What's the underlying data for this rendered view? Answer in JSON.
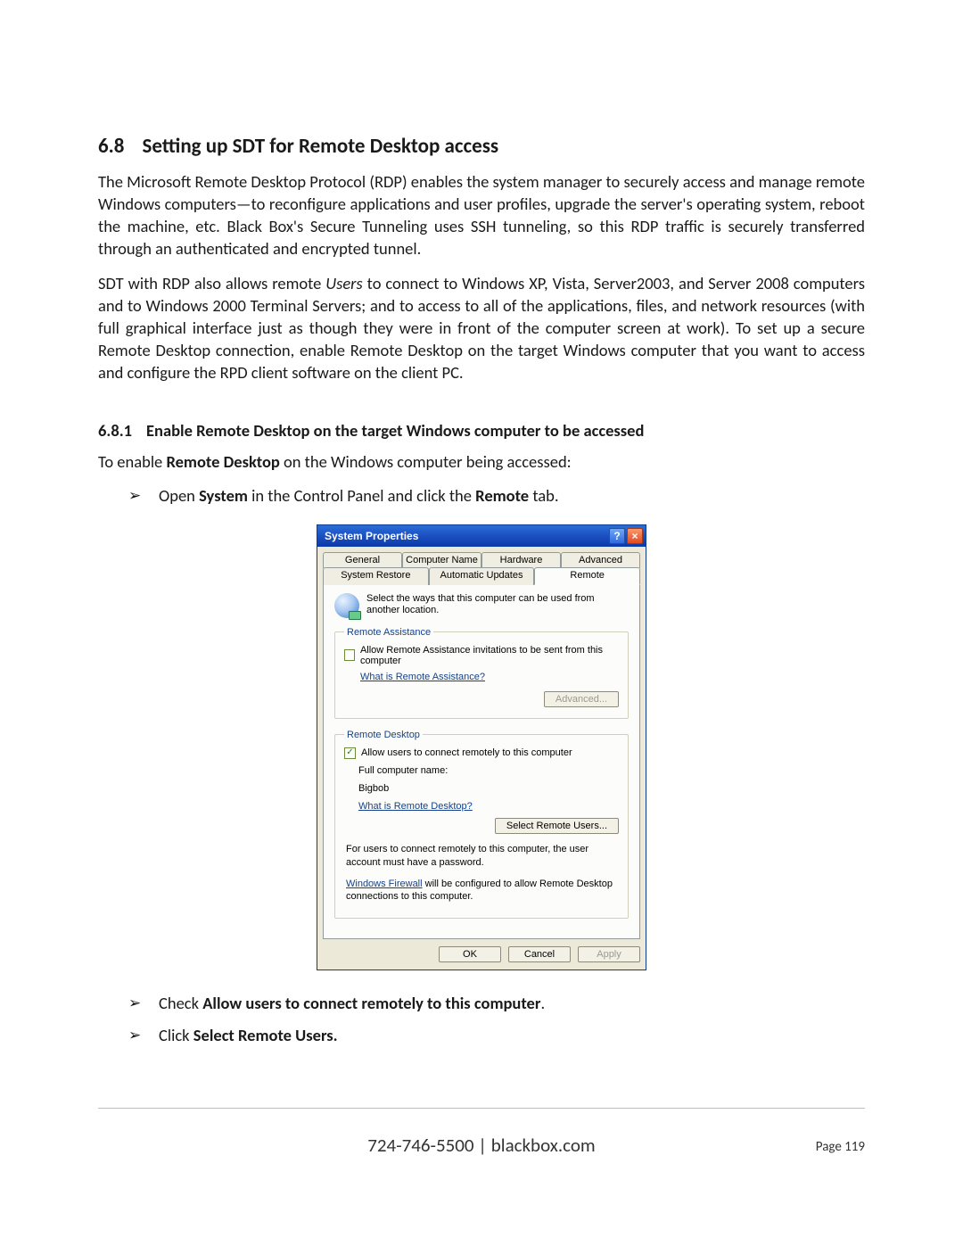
{
  "section": {
    "number": "6.8",
    "title": "Setting up SDT for Remote Desktop access"
  },
  "para1_a": "The Microsoft Remote Desktop Protocol (RDP) enables the system manager to securely access and manage remote Windows computers—to reconfigure applications and user profiles, upgrade the server's operating system, reboot the machine, etc. Black Box's Secure Tunneling uses SSH tunneling, so this RDP traffic is securely transferred through an authenticated and encrypted tunnel.",
  "para2_a": "SDT with RDP also allows remote ",
  "para2_em": "Users",
  "para2_b": " to connect to Windows XP, Vista, Server2003, and Server 2008 computers and to Windows 2000 Terminal Servers; and to access to all of the applications, files, and network resources (with full graphical interface just as though they were in front of the computer screen at work). To set up a secure Remote Desktop connection, enable Remote Desktop on the target Windows computer that you want to access and configure the RPD client software on the client PC.",
  "subsection": {
    "number": "6.8.1",
    "title": "Enable Remote Desktop on the target Windows computer to be accessed"
  },
  "lead_a": "To enable ",
  "lead_b_strong": "Remote Desktop",
  "lead_c": " on the Windows computer being accessed:",
  "bullet1_a": "Open ",
  "bullet1_b_strong": "System",
  "bullet1_c": " in the Control Panel and click the ",
  "bullet1_d_strong": "Remote",
  "bullet1_e": " tab.",
  "bullet2_a": "Check ",
  "bullet2_b_strong": "Allow users to connect remotely to this computer",
  "bullet2_c": ".",
  "bullet3_a": "Click ",
  "bullet3_b_strong": "Select Remote Users.",
  "dialog": {
    "title": "System Properties",
    "tabs_row1": [
      "General",
      "Computer Name",
      "Hardware",
      "Advanced"
    ],
    "tabs_row2": [
      "System Restore",
      "Automatic Updates",
      "Remote"
    ],
    "active_tab": "Remote",
    "intro": "Select the ways that this computer can be used from another location.",
    "ra": {
      "legend": "Remote Assistance",
      "checkbox": "Allow Remote Assistance invitations to be sent from this computer",
      "link": "What is Remote Assistance?",
      "advanced_btn": "Advanced..."
    },
    "rd": {
      "legend": "Remote Desktop",
      "checkbox": "Allow users to connect remotely to this computer",
      "fullname_label": "Full computer name:",
      "fullname_value": "Bigbob",
      "link": "What is Remote Desktop?",
      "select_btn": "Select Remote Users...",
      "note1": "For users to connect remotely to this computer, the user account must have a password.",
      "note2_link": "Windows Firewall",
      "note2_rest": " will be configured to allow Remote Desktop connections to this computer."
    },
    "buttons": {
      "ok": "OK",
      "cancel": "Cancel",
      "apply": "Apply"
    }
  },
  "footer": {
    "center": "724-746-5500 | blackbox.com",
    "right": "Page 119"
  }
}
